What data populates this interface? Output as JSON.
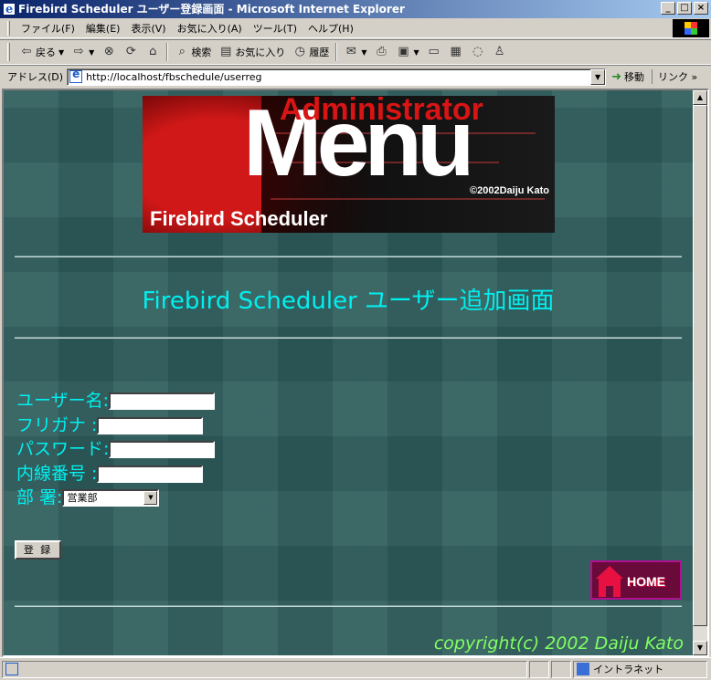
{
  "window": {
    "title": "Firebird Scheduler ユーザー登録画面 - Microsoft Internet Explorer",
    "buttons": {
      "minimize": "_",
      "maximize": "□",
      "close": "×"
    }
  },
  "menubar": {
    "items": [
      "ファイル(F)",
      "編集(E)",
      "表示(V)",
      "お気に入り(A)",
      "ツール(T)",
      "ヘルプ(H)"
    ]
  },
  "toolbar": {
    "back": "戻る",
    "search": "検索",
    "favorites": "お気に入り",
    "history": "履歴"
  },
  "addressbar": {
    "label": "アドレス(D)",
    "url": "http://localhost/fbschedule/userreg",
    "go": "移動",
    "links": "リンク »"
  },
  "banner": {
    "administrator": "Administrator",
    "menu": "Menu",
    "copyright": "©2002Daiju Kato",
    "app_name": "Firebird Scheduler"
  },
  "page": {
    "heading": "Firebird Scheduler ユーザー追加画面",
    "form": {
      "username_label": "ユーザー名:",
      "furigana_label": "フリガナ :",
      "password_label": "パスワード:",
      "extension_label": "内線番号 :",
      "department_label": "部 署:",
      "department_selected": "営業部",
      "username_value": "",
      "furigana_value": "",
      "password_value": "",
      "extension_value": ""
    },
    "submit_label": "登 録",
    "home_label": "HOME",
    "copyright": "copyright(c) 2002 Daiju Kato"
  },
  "statusbar": {
    "zone": "イントラネット"
  }
}
